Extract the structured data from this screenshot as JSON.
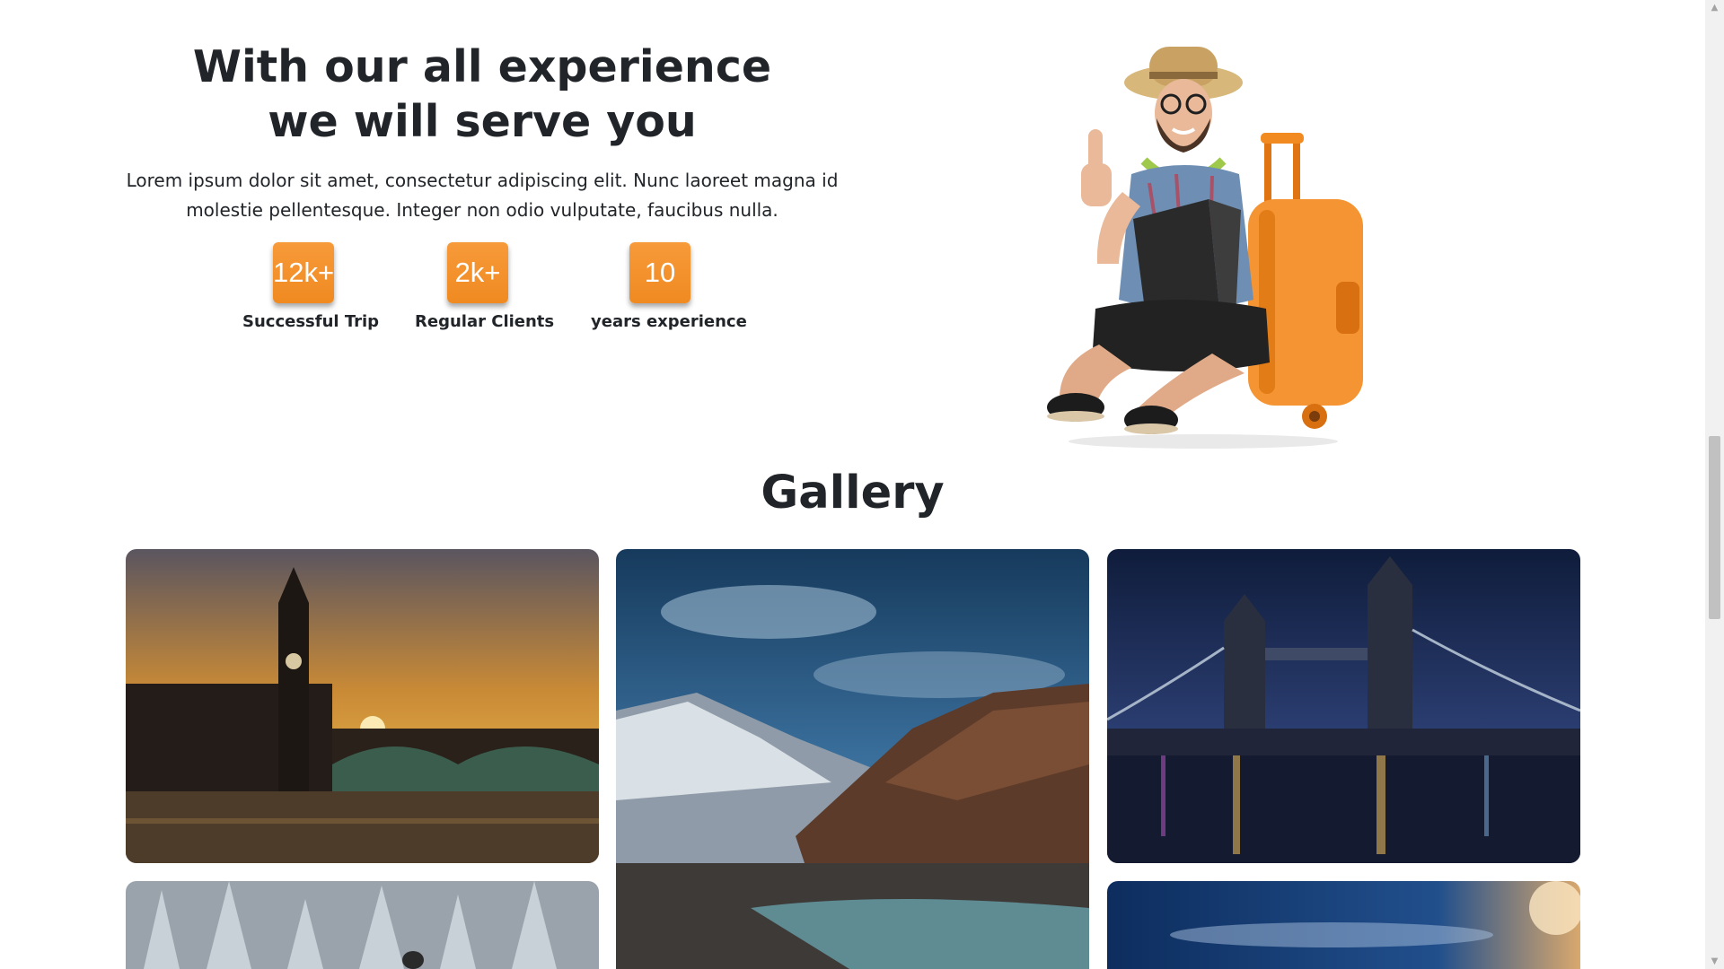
{
  "experience": {
    "title_line1": "With our all experience",
    "title_line2": "we will serve you",
    "text_line1": "Lorem ipsum dolor sit amet, consectetur adipiscing elit. Nunc laoreet magna id",
    "text_line2": "molestie pellentesque. Integer non odio vulputate, faucibus nulla.",
    "stats": [
      {
        "value": "12k+",
        "label": "Successful Trip"
      },
      {
        "value": "2k+",
        "label": "Regular Clients"
      },
      {
        "value": "10",
        "label": "years experience"
      }
    ]
  },
  "gallery": {
    "title": "Gallery"
  },
  "colors": {
    "accent": "#f39332",
    "heading": "#212529",
    "scrollbar_track": "#f1f1f1",
    "scrollbar_thumb": "#c1c1c1"
  }
}
